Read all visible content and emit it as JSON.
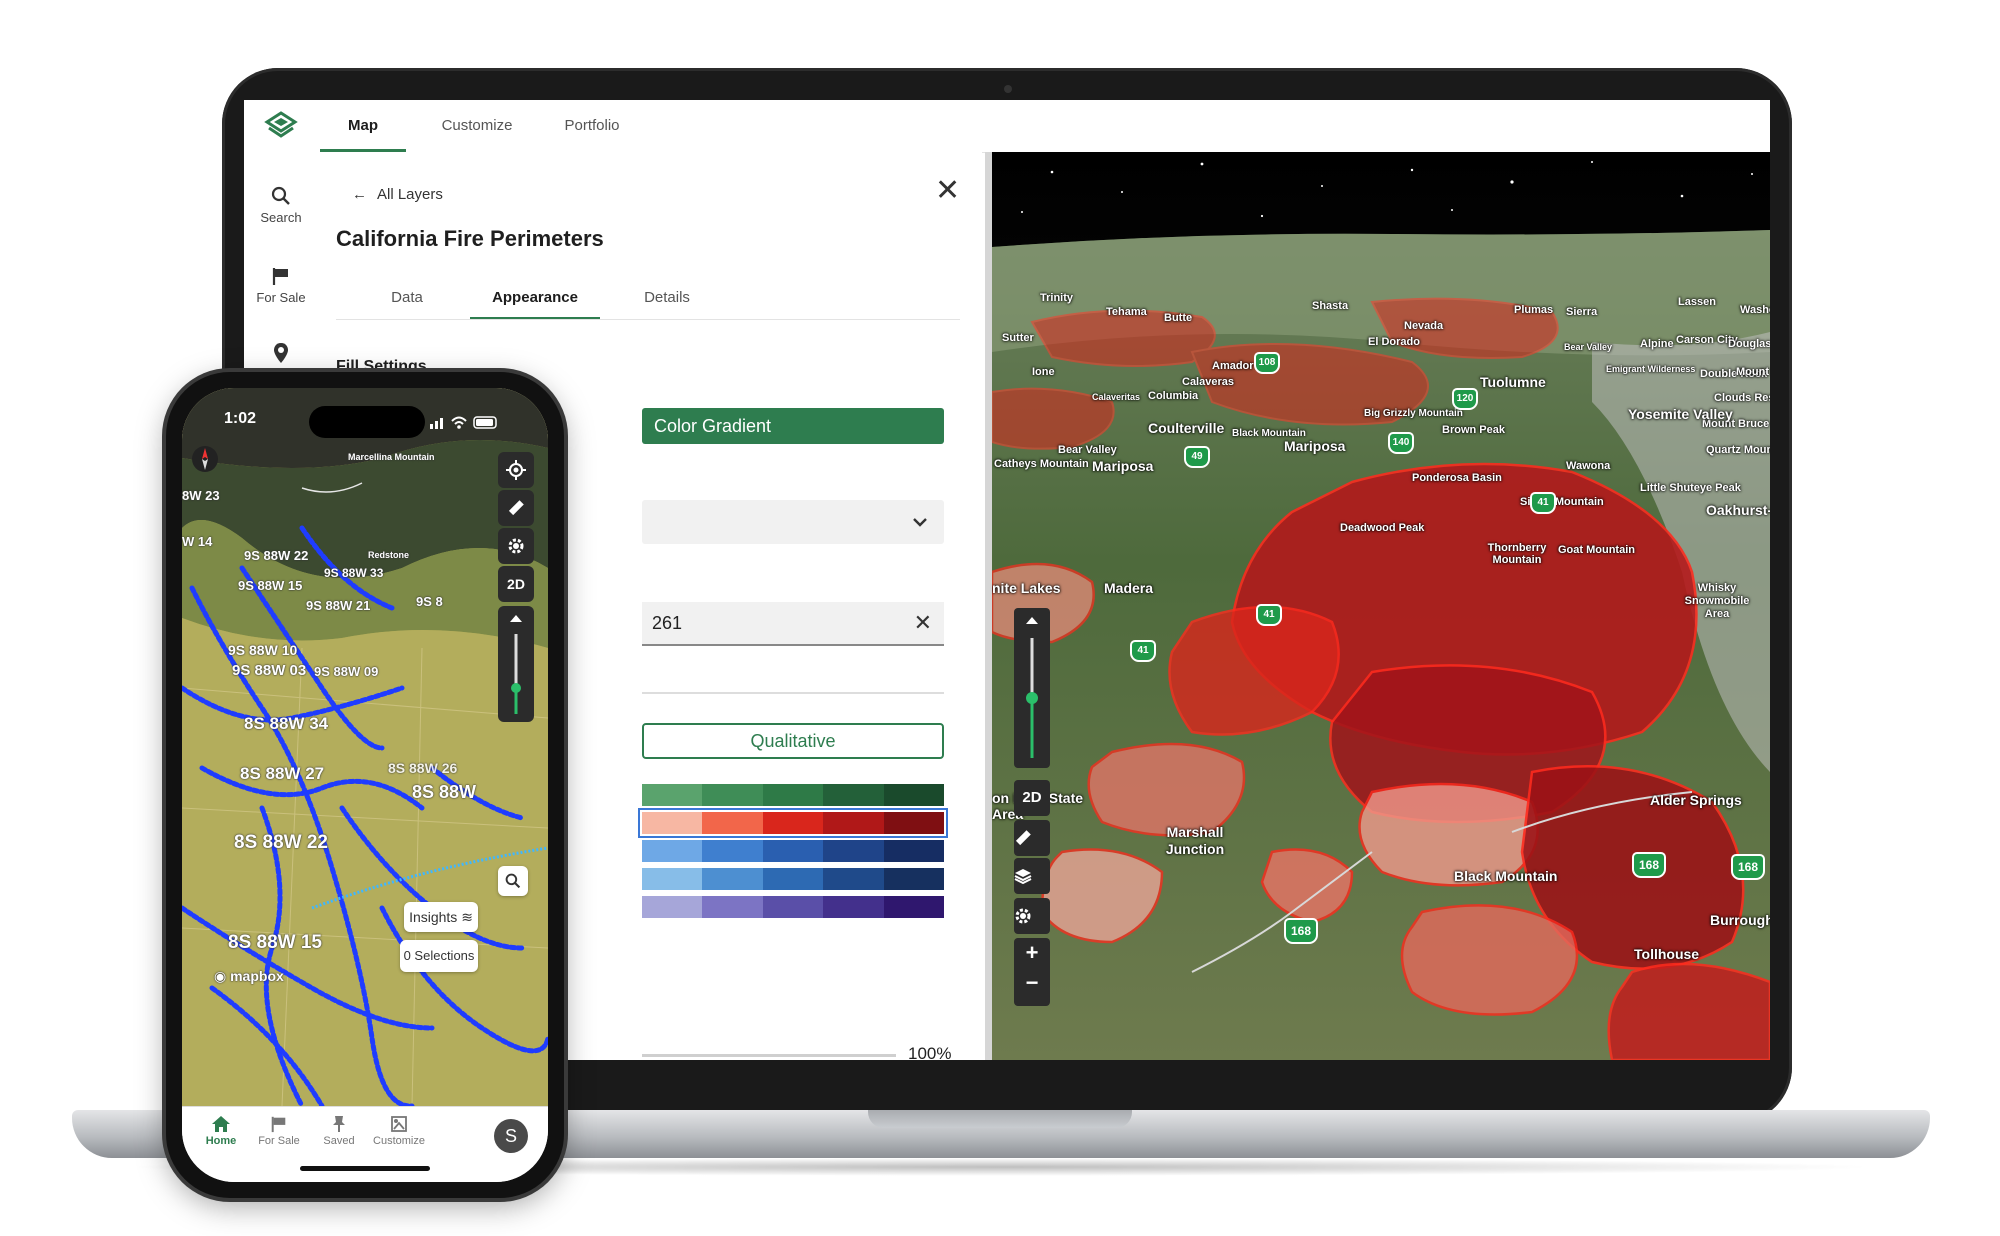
{
  "laptop": {
    "nav": {
      "map": "Map",
      "customize": "Customize",
      "portfolio": "Portfolio"
    },
    "rail": {
      "search": "Search",
      "for_sale": "For Sale"
    },
    "panel": {
      "back": "All Layers",
      "title": "California Fire Perimeters",
      "tabs": {
        "data": "Data",
        "appearance": "Appearance",
        "details": "Details"
      },
      "section": "Fill Settings",
      "gradient_button": "Color Gradient",
      "field_value": "261",
      "qualitative_button": "Qualitative",
      "opacity_value": "100%"
    },
    "map": {
      "labels": [
        "Trinity",
        "Tehama",
        "Butte",
        "Shasta",
        "Plumas",
        "Sierra",
        "Lassen",
        "Washoe",
        "Sutter",
        "Nevada",
        "El Dorado",
        "Bear Valley",
        "Alpine",
        "Carson City",
        "Douglas",
        "Amador",
        "Emigrant Wilderness",
        "Calaveras",
        "Columbia",
        "Tuolumne",
        "Double Rock",
        "Coulterville",
        "Big Grizzly Mountain",
        "Clouds Rest",
        "Mount Bruce",
        "Yosemite Valley",
        "Black Mountain",
        "Brown Peak",
        "Quartz Mountain",
        "Bear Valley",
        "Mariposa",
        "Catheys Mountain",
        "Mariposa",
        "Wawona",
        "Ponderosa Basin",
        "Little Shuteye Peak",
        "Sivels Mountain",
        "Oakhurst-Nor",
        "Deadwood Peak",
        "Thornberry Mountain",
        "Goat Mountain",
        "nite Lakes",
        "Madera",
        "Whisky Snowmobile Area",
        "on Lake State Area",
        "Marshall Junction",
        "Alder Springs",
        "Black Mountain",
        "Burrough",
        "Tollhouse",
        "Ione",
        "Mount",
        "Calaveritas"
      ],
      "highways": [
        "168",
        "168",
        "168",
        "41",
        "41",
        "41",
        "140",
        "49",
        "120",
        "108"
      ],
      "controls": {
        "mode_2d": "2D",
        "zoom_in": "+",
        "zoom_out": "−"
      }
    }
  },
  "phone": {
    "status_time": "1:02",
    "labels": [
      "9S 88W 22",
      "9S 88W 33",
      "9S 88W 15",
      "9S 88W 21",
      "9S 88W 10",
      "9S 88W 03",
      "9S 88W 09",
      "8S 88W 34",
      "8S 88W 27",
      "8S 88W",
      "8S 88W 22",
      "8S 88W 15",
      "8S 88W 26",
      "8W 23",
      "W 14",
      "Redstone",
      "Marcellina Mountain",
      "9S 8"
    ],
    "buttons": {
      "mode_2d": "2D",
      "insights": "Insights",
      "selections": "0 Selections"
    },
    "attribution": "mapbox",
    "tabs": {
      "home": "Home",
      "for_sale": "For Sale",
      "saved": "Saved",
      "customize": "Customize"
    },
    "avatar": "S"
  },
  "colors": {
    "brand_green": "#2e7d4f",
    "fire_red": "#d9261c",
    "trail_blue": "#1f3cff",
    "ramp_green": [
      "#5aa36d",
      "#3f8d57",
      "#2e7a47",
      "#236039",
      "#1a4a2c"
    ],
    "ramp_red": [
      "#f7b7a3",
      "#f2664a",
      "#d9261c",
      "#b01818",
      "#7f0f12"
    ],
    "ramp_blue1": [
      "#6ea8e6",
      "#3f7fcf",
      "#2a5fb0",
      "#1f4489",
      "#162d63"
    ],
    "ramp_blue2": [
      "#87bde8",
      "#4d8fd1",
      "#2d6ab3",
      "#1f4a8a",
      "#16305f"
    ],
    "ramp_purple": [
      "#a6a6d9",
      "#7c74c4",
      "#5a4fa8",
      "#43308c",
      "#2f176e"
    ]
  }
}
